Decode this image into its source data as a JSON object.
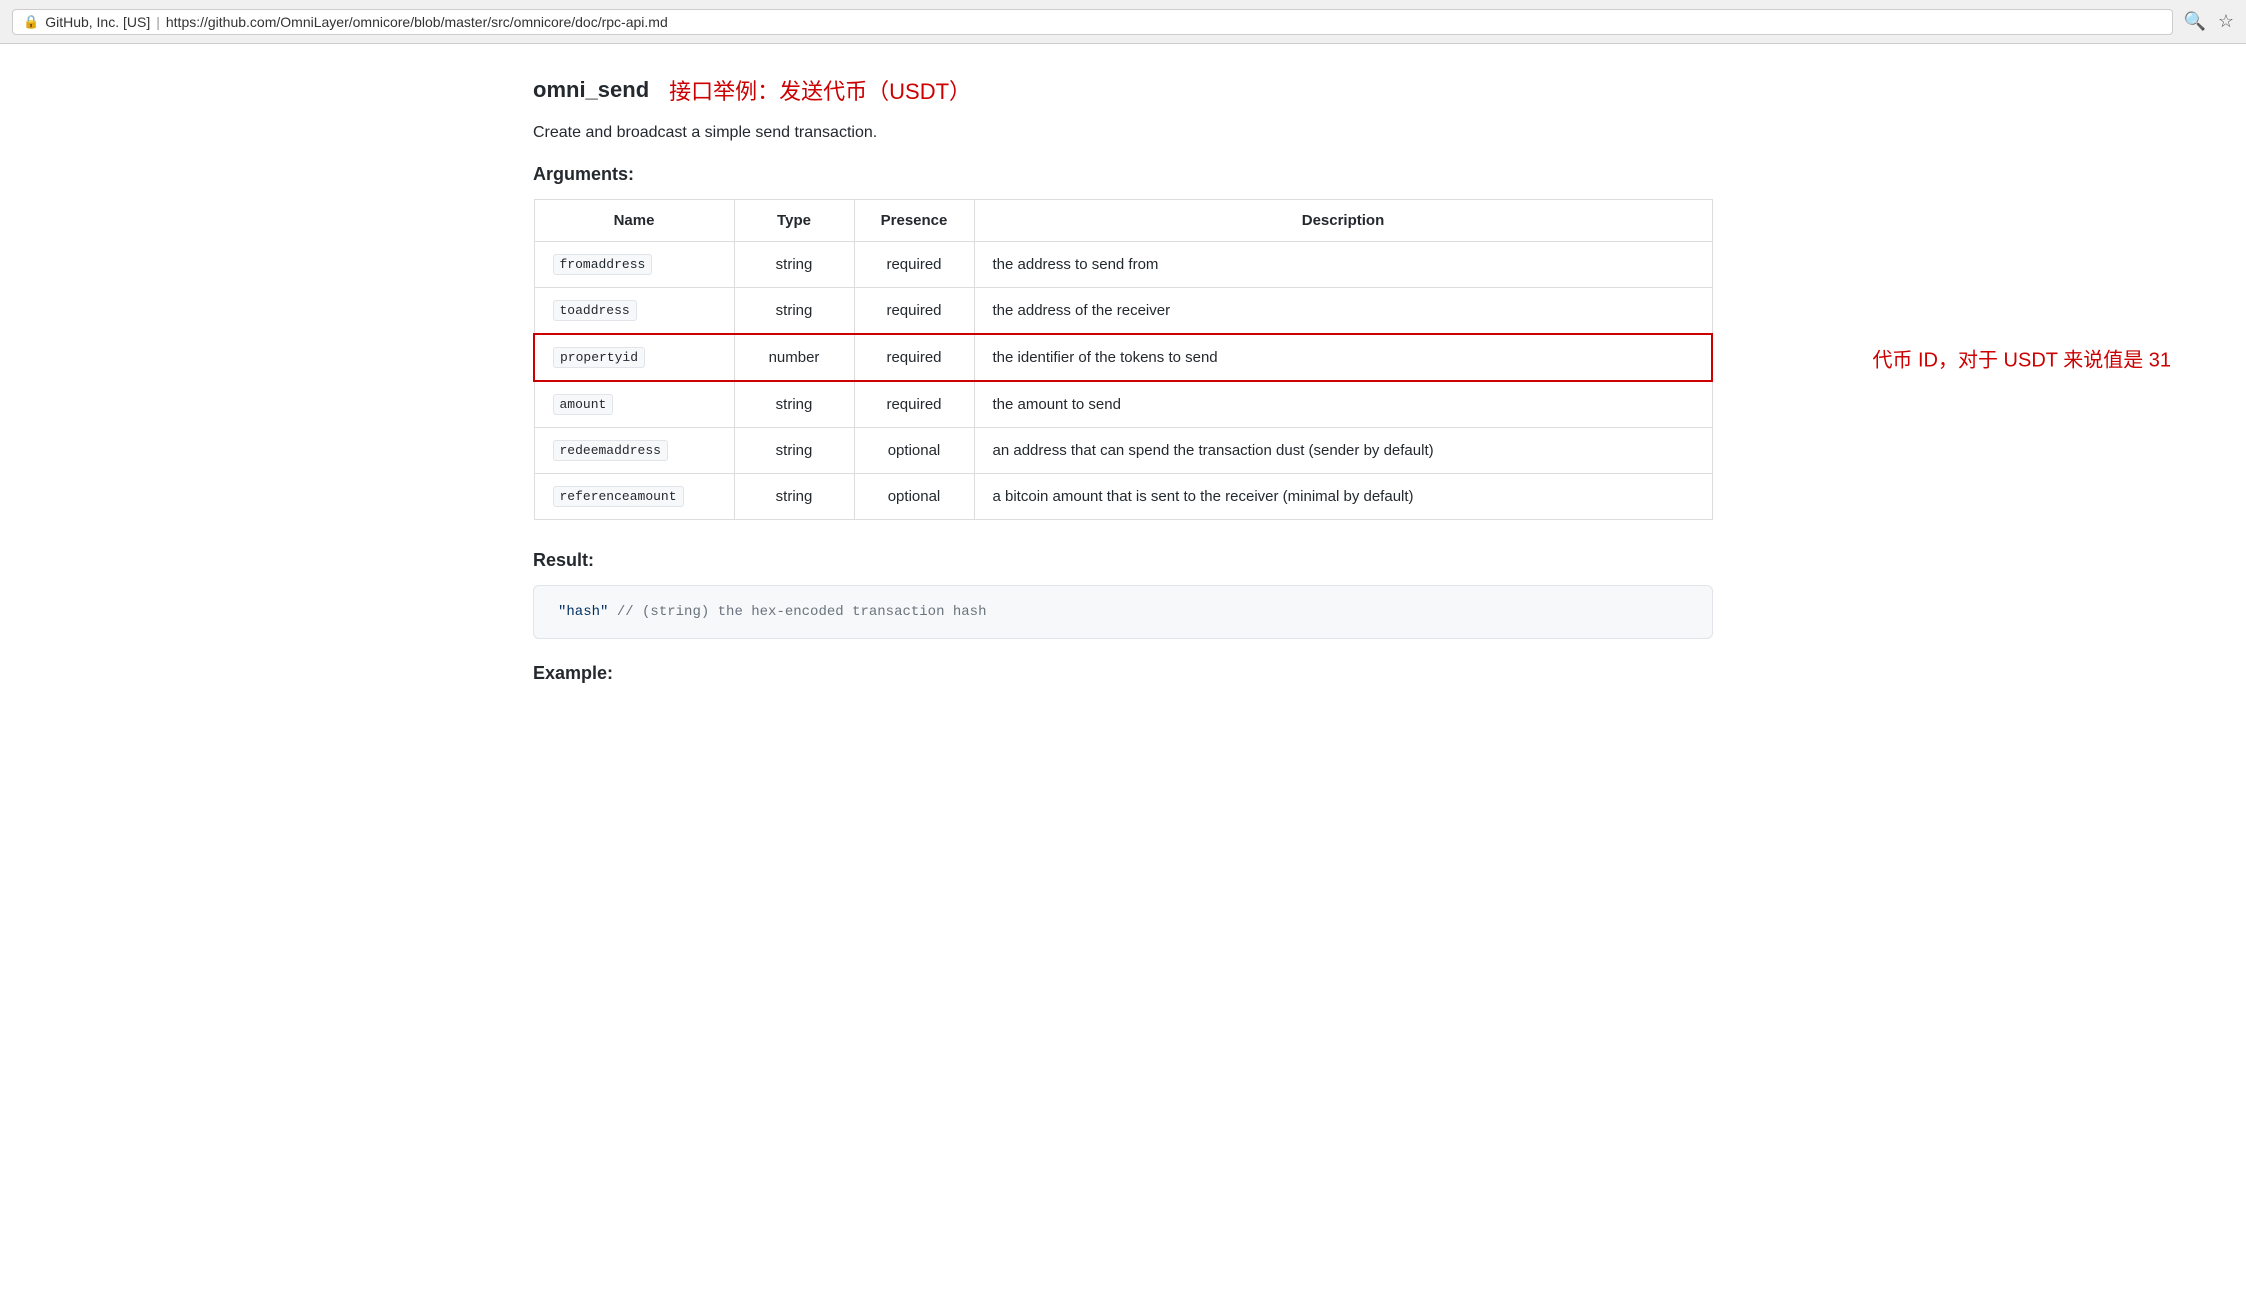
{
  "browser": {
    "secure_label": "GitHub, Inc. [US]",
    "url_full": "https://github.com/OmniLayer/omnicore/blob/master/src/omnicore/doc/rpc-api.md",
    "url_origin": "https://github.com",
    "url_path": "/OmniLayer/omnicore/blob/master/src/omnicore/doc/rpc-api.md"
  },
  "page": {
    "function_name": "omni_send",
    "heading_annotation": "接口举例：发送代币（USDT）",
    "description": "Create and broadcast a simple send transaction.",
    "arguments_title": "Arguments:",
    "result_title": "Result:",
    "example_title": "Example:",
    "table": {
      "headers": [
        "Name",
        "Type",
        "Presence",
        "Description"
      ],
      "rows": [
        {
          "name": "fromaddress",
          "type": "string",
          "presence": "required",
          "description": "the address to send from",
          "highlighted": false
        },
        {
          "name": "toaddress",
          "type": "string",
          "presence": "required",
          "description": "the address of the receiver",
          "highlighted": false
        },
        {
          "name": "propertyid",
          "type": "number",
          "presence": "required",
          "description": "the identifier of the tokens to send",
          "highlighted": true,
          "annotation": "代币 ID，对于 USDT 来说值是 31"
        },
        {
          "name": "amount",
          "type": "string",
          "presence": "required",
          "description": "the amount to send",
          "highlighted": false
        },
        {
          "name": "redeemaddress",
          "type": "string",
          "presence": "optional",
          "description": "an address that can spend the transaction dust (sender by default)",
          "highlighted": false
        },
        {
          "name": "referenceamount",
          "type": "string",
          "presence": "optional",
          "description": "a bitcoin amount that is sent to the receiver (minimal by default)",
          "highlighted": false
        }
      ]
    },
    "result_code": "\"hash\"  // (string) the hex-encoded transaction hash"
  }
}
